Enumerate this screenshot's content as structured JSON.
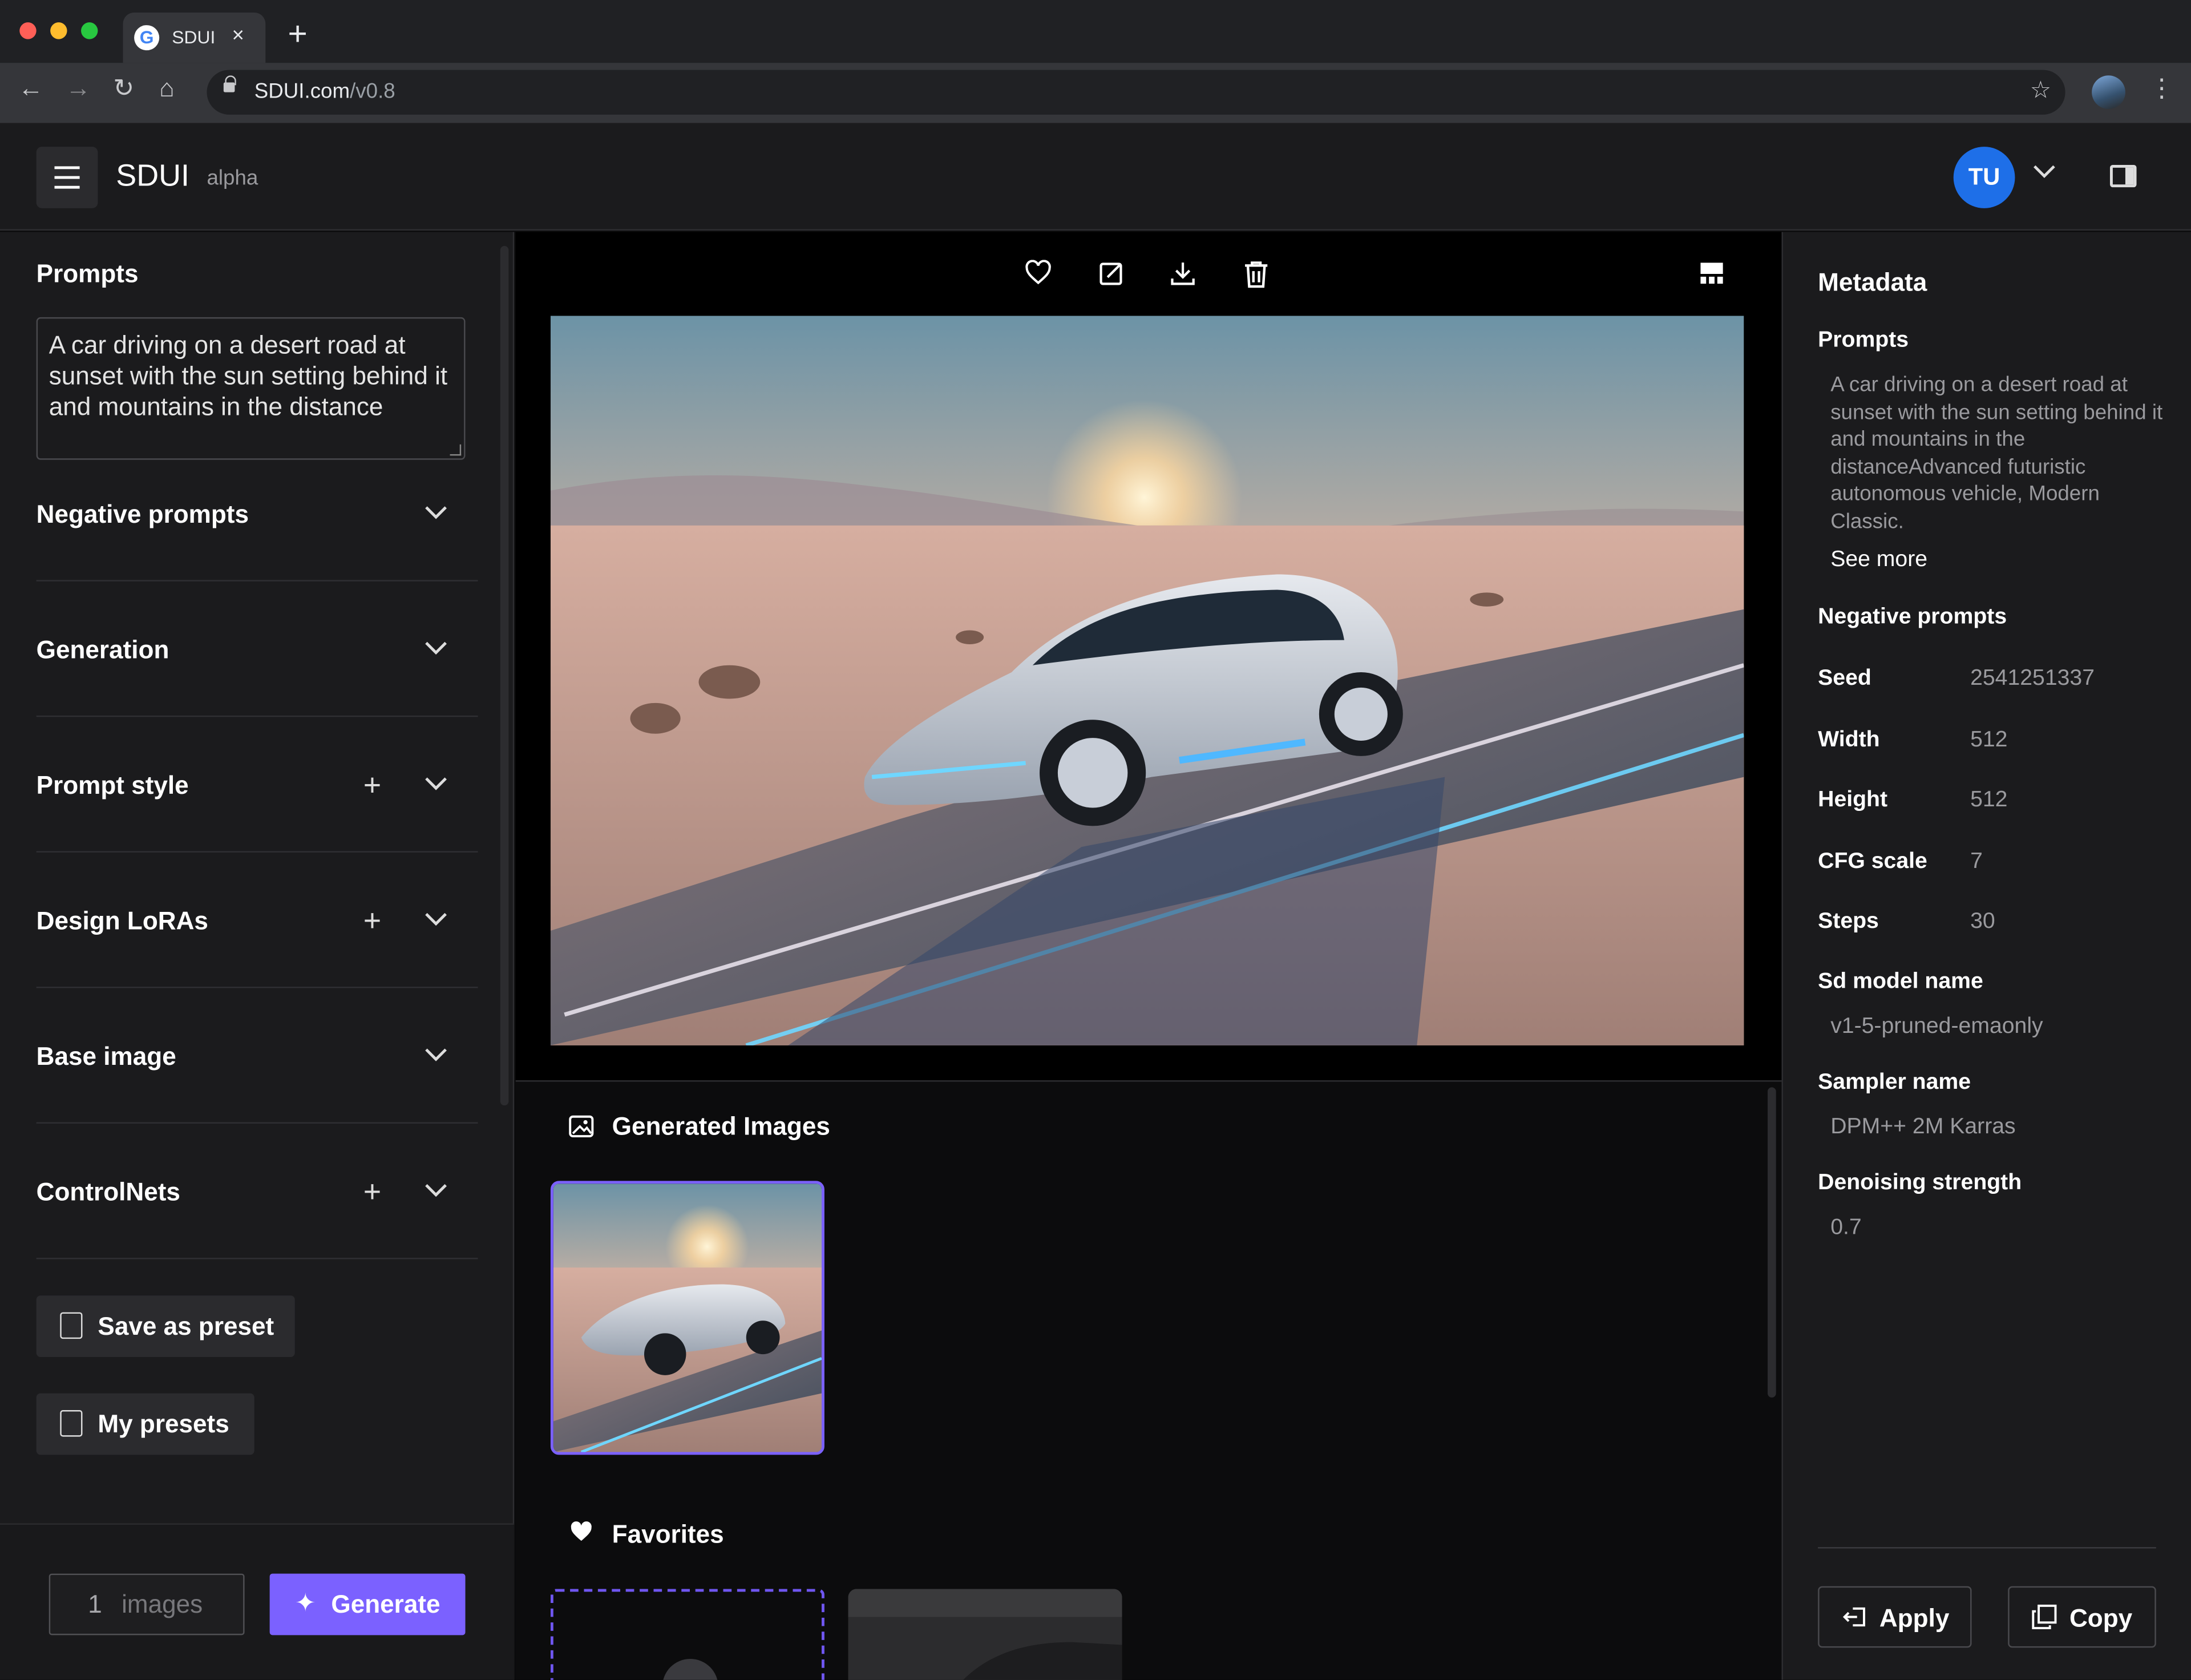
{
  "browser": {
    "tab_title": "SDUI",
    "url_host": "SDUI.com",
    "url_path": "/v0.8"
  },
  "app": {
    "name": "SDUI",
    "badge": "alpha",
    "user_initials": "TU"
  },
  "left": {
    "prompts_title": "Prompts",
    "prompt_text": "A car driving on a desert road at sunset with the sun setting behind it and mountains in the distance",
    "sections": [
      {
        "label": "Negative prompts",
        "has_add": false
      },
      {
        "label": "Generation",
        "has_add": false
      },
      {
        "label": "Prompt style",
        "has_add": true
      },
      {
        "label": "Design LoRAs",
        "has_add": true
      },
      {
        "label": "Base image",
        "has_add": false
      },
      {
        "label": "ControlNets",
        "has_add": true
      }
    ],
    "save_preset_label": "Save as preset",
    "my_presets_label": "My presets",
    "image_count": "1",
    "image_count_unit": "images",
    "generate_label": "Generate"
  },
  "main": {
    "generated_title": "Generated Images",
    "favorites_title": "Favorites"
  },
  "metadata": {
    "title": "Metadata",
    "prompts_label": "Prompts",
    "prompt_text": "A car driving on a desert road at sunset with the sun setting behind it and mountains in the distanceAdvanced futuristic autonomous vehicle, Modern Classic.",
    "see_more": "See more",
    "negative_label": "Negative prompts",
    "seed_label": "Seed",
    "seed": "2541251337",
    "width_label": "Width",
    "width": "512",
    "height_label": "Height",
    "height": "512",
    "cfg_label": "CFG scale",
    "cfg": "7",
    "steps_label": "Steps",
    "steps": "30",
    "model_label": "Sd model name",
    "model": "v1-5-pruned-emaonly",
    "sampler_label": "Sampler name",
    "sampler": "DPM++ 2M Karras",
    "denoise_label": "Denoising strength",
    "denoise": "0.7",
    "apply_label": "Apply",
    "copy_label": "Copy"
  },
  "colors": {
    "accent": "#7b61ff",
    "avatar": "#1e6fe8",
    "panel": "#1b1b1d"
  }
}
